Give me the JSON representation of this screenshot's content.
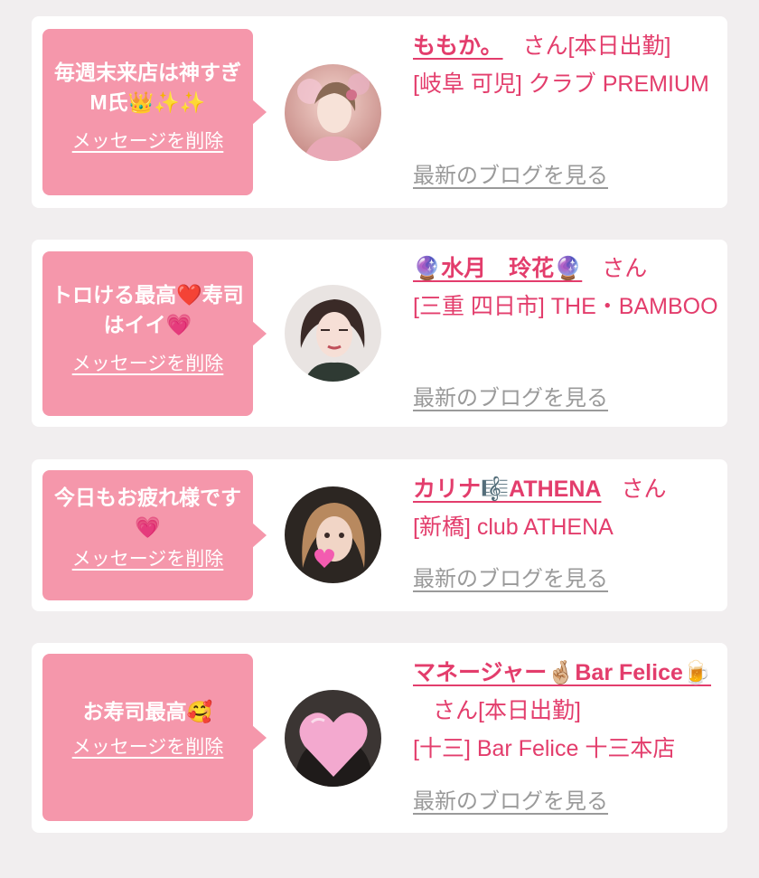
{
  "delete_label": "メッセージを削除",
  "blog_label": "最新のブログを見る",
  "san_suffix": "さん",
  "colors": {
    "page_background": "#f1eeef",
    "card_background": "#ffffff",
    "bubble_pink": "#f597ab",
    "name_pink": "#e33d6c",
    "link_gray": "#9a9a9a"
  },
  "cards": [
    {
      "message": "毎週末来店は神すぎM氏👑✨✨",
      "name": "ももか。",
      "after_name": "[本日出勤]",
      "shop_line": "[岐阜 可児] クラブ PREMIUM",
      "avatar_icon": "woman-with-hair-ornament-photo"
    },
    {
      "message": "トロける最高❤️寿司はイイ💗",
      "name": "🔮水月　玲花🔮",
      "after_name": "",
      "shop_line": "[三重 四日市] THE・BAMBOO",
      "avatar_icon": "woman-portrait-photo"
    },
    {
      "message": "今日もお疲れ様です💗",
      "name": "カリナ🎼ATHENA",
      "after_name": "",
      "shop_line": "[新橋] club ATHENA",
      "avatar_icon": "woman-portrait-heart-photo"
    },
    {
      "message": "お寿司最高🥰",
      "name": "マネージャー🤞🏼Bar Felice🍺",
      "after_name": "[本日出勤]",
      "shop_line": "[十三] Bar Felice 十三本店",
      "avatar_icon": "face-hidden-by-heart-photo"
    }
  ]
}
